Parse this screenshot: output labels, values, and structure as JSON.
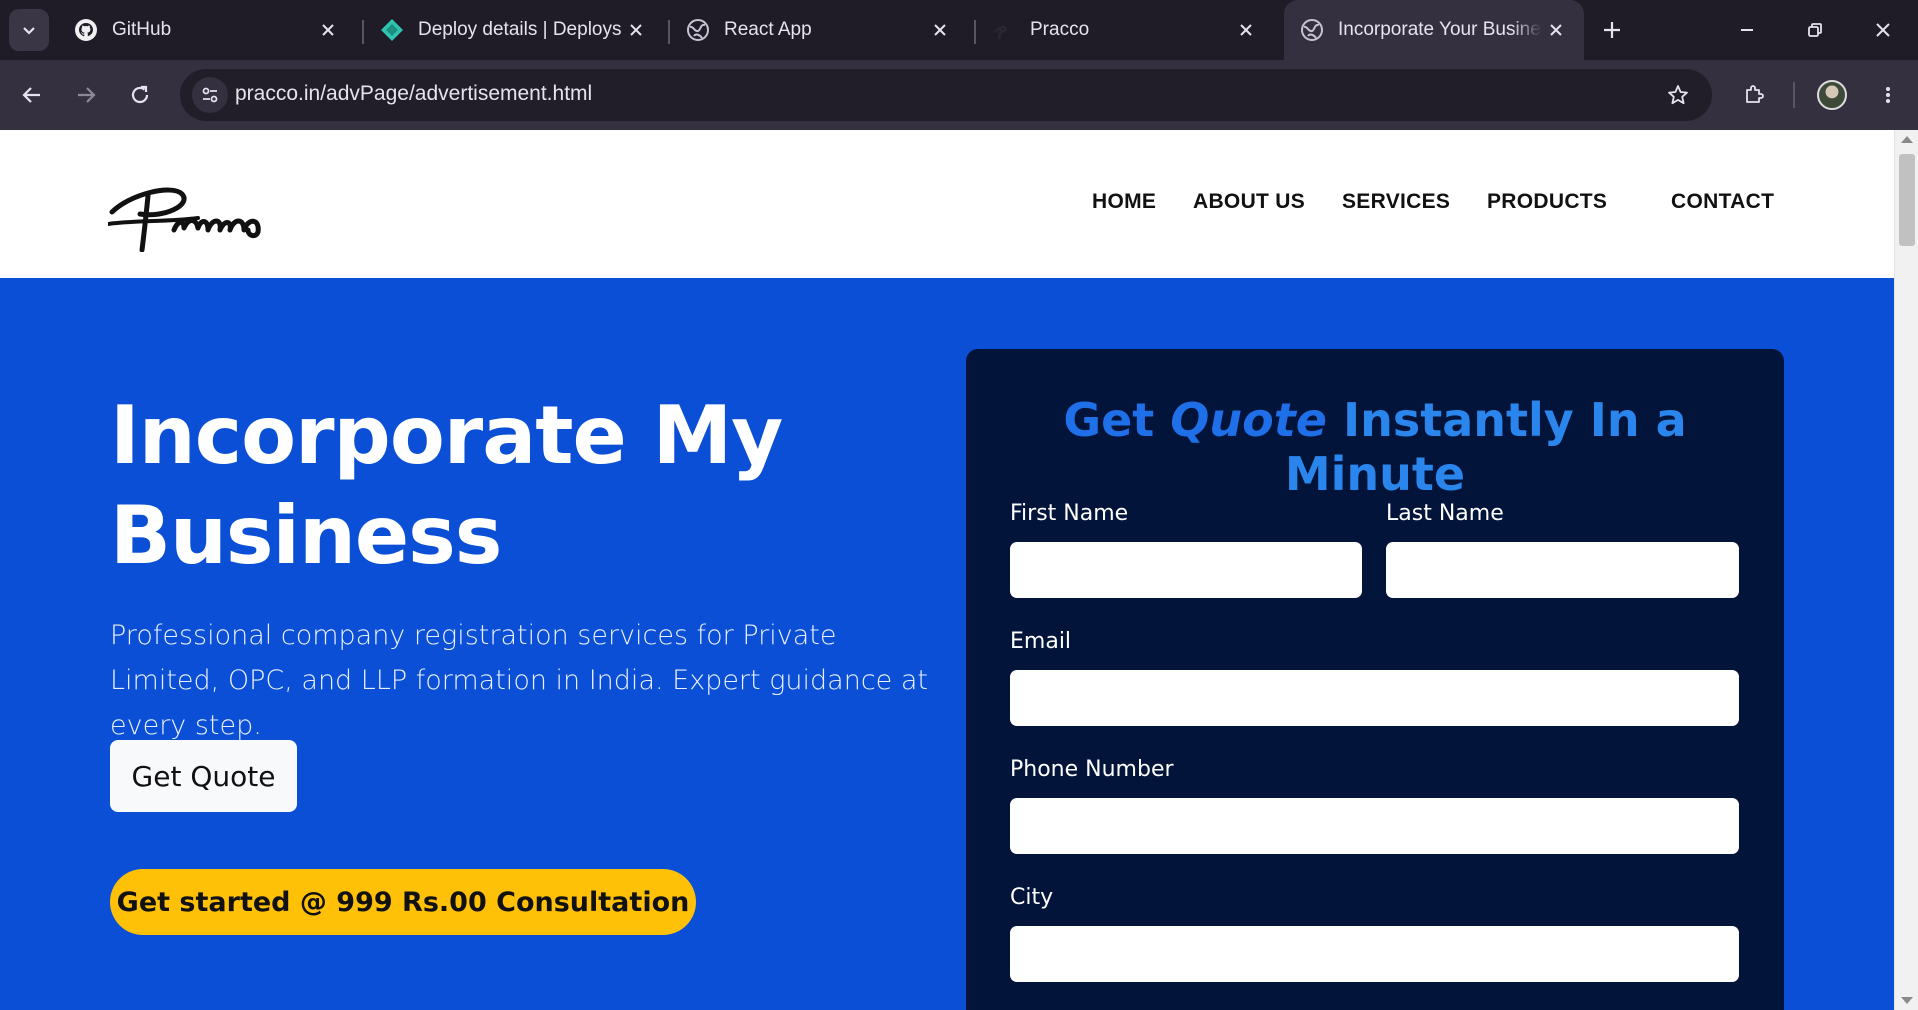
{
  "browser": {
    "tabs": [
      {
        "title": "GitHub",
        "icon": "github-icon"
      },
      {
        "title": "Deploy details | Deploys |",
        "icon": "netlify-icon"
      },
      {
        "title": "React App",
        "icon": "globe-icon"
      },
      {
        "title": "Pracco",
        "icon": "pracco-favicon"
      },
      {
        "title": "Incorporate Your Business",
        "icon": "globe-icon",
        "active": true
      }
    ],
    "url": "pracco.in/advPage/advertisement.html"
  },
  "site": {
    "logo_text": "Pracco",
    "nav": {
      "home": "HOME",
      "about": "ABOUT US",
      "services": "SERVICES",
      "products": "PRODUCTS",
      "contact": "CONTACT"
    }
  },
  "hero": {
    "title": "Incorporate My Business",
    "description": "Professional company registration services for Private Limited, OPC, and LLP formation in India. Expert guidance at every step.",
    "quote_button": "Get Quote",
    "start_button": "Get started @ 999 Rs.00 Consultation"
  },
  "form": {
    "heading_pre": "Get ",
    "heading_em": "Quote",
    "heading_post": " Instantly In a Minute",
    "first_name_label": "First Name",
    "last_name_label": "Last Name",
    "email_label": "Email",
    "phone_label": "Phone Number",
    "city_label": "City"
  },
  "colors": {
    "hero_bg": "#0a4fd6",
    "form_bg": "#03143a",
    "heading_blue": "#1f6fe8",
    "cta_yellow": "#ffc107"
  }
}
